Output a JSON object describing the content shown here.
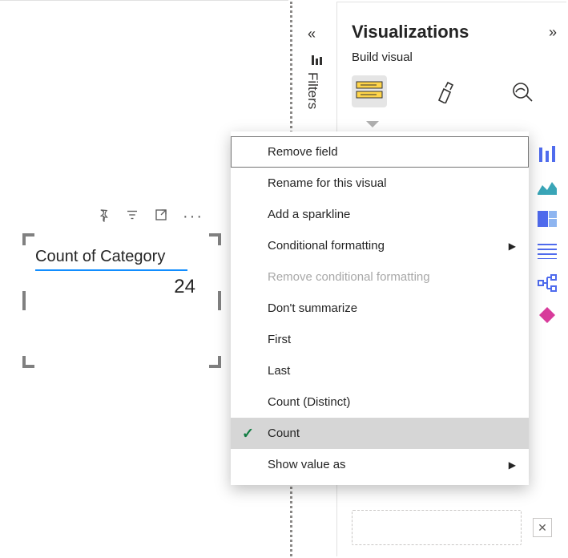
{
  "card": {
    "title": "Count of Category",
    "value": "24"
  },
  "filters_rail": {
    "label": "Filters"
  },
  "visualizations": {
    "title": "Visualizations",
    "subtitle": "Build visual"
  },
  "context_menu": {
    "items": [
      {
        "label": "Remove field",
        "state": "hover"
      },
      {
        "label": "Rename for this visual",
        "state": ""
      },
      {
        "label": "Add a sparkline",
        "state": ""
      },
      {
        "label": "Conditional formatting",
        "state": "submenu"
      },
      {
        "label": "Remove conditional formatting",
        "state": "disabled"
      },
      {
        "label": "Don't summarize",
        "state": ""
      },
      {
        "label": "First",
        "state": ""
      },
      {
        "label": "Last",
        "state": ""
      },
      {
        "label": "Count (Distinct)",
        "state": ""
      },
      {
        "label": "Count",
        "state": "selected"
      },
      {
        "label": "Show value as",
        "state": "submenu"
      }
    ]
  }
}
